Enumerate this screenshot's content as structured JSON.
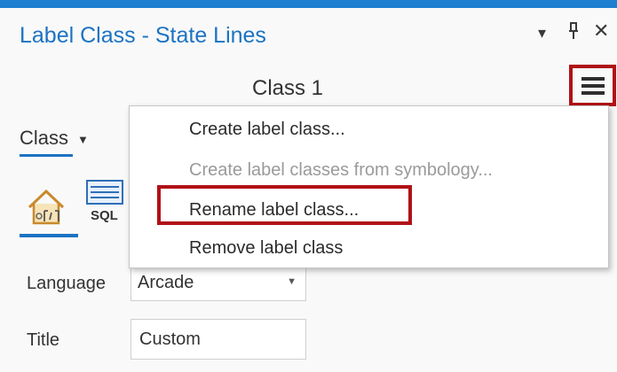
{
  "pane": {
    "title": "Label Class - State Lines",
    "controls": {
      "menu_icon": "triangle-down",
      "pin_icon": "pin",
      "close_icon": "close"
    }
  },
  "class_header": {
    "name": "Class 1",
    "menu_icon": "hamburger-menu"
  },
  "class_tab": {
    "label": "Class"
  },
  "tools": {
    "labels_icon": "label-class-properties",
    "sql_label": "SQL"
  },
  "form": {
    "language_label": "Language",
    "language_value": "Arcade",
    "title_label": "Title",
    "title_value": "Custom"
  },
  "context_menu": {
    "items": [
      {
        "label": "Create label class...",
        "enabled": true
      },
      {
        "label": "Create label classes from symbology...",
        "enabled": false
      },
      {
        "label": "Rename label class...",
        "enabled": true,
        "highlighted": true
      },
      {
        "label": "Remove label class",
        "enabled": true
      }
    ]
  },
  "colors": {
    "accent": "#1c73c2",
    "highlight_border": "#b01116",
    "top_border": "#1f7fd1"
  }
}
